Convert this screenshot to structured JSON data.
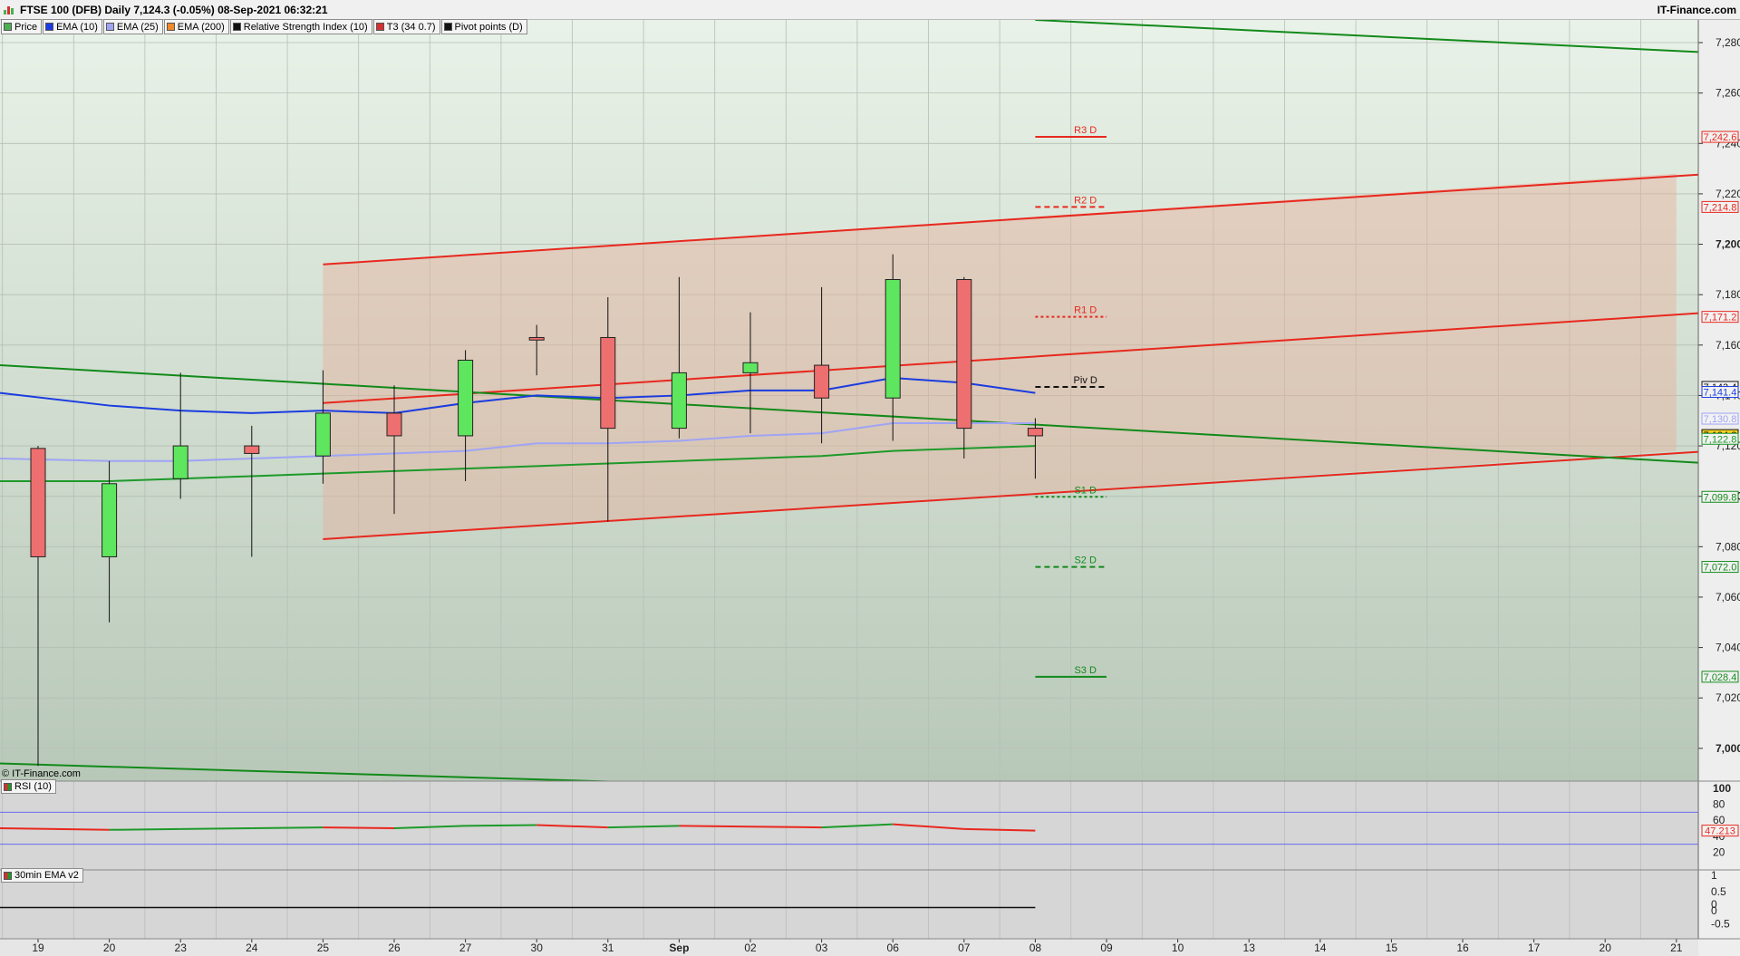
{
  "header": {
    "title": "FTSE 100 (DFB) Daily 7,124.3 (-0.05%) 08-Sep-2021 06:32:21",
    "brand": "IT-Finance.com"
  },
  "legend": [
    {
      "label": "Price",
      "color": "#4caf50"
    },
    {
      "label": "EMA (10)",
      "color": "#1a3ce0"
    },
    {
      "label": "EMA (25)",
      "color": "#9fa4f5"
    },
    {
      "label": "EMA (200)",
      "color": "#f08a2a"
    },
    {
      "label": "Relative Strength Index (10)",
      "color": "#111111"
    },
    {
      "label": "T3 (34 0.7)",
      "color": "#d63030"
    },
    {
      "label": "Pivot points (D)",
      "color": "#111111"
    }
  ],
  "copyright": "© IT-Finance.com",
  "rsi_panel": {
    "label": "RSI (10)",
    "value_tag": "47.213",
    "ticks": [
      "100",
      "80",
      "60",
      "40",
      "20"
    ]
  },
  "ema_panel": {
    "label": "30min EMA v2",
    "ticks": [
      "1",
      "0.5",
      "0",
      "0",
      "-0.5"
    ]
  },
  "colors": {
    "up": "#5ee65e",
    "down": "#ee6f6f",
    "ema10": "#1a3ce0",
    "ema25": "#9fa4f5",
    "ema200": "#1d9a2a",
    "channel_red": "#e8281e",
    "channel_green": "#128a1a",
    "pivot_red": "#e8281e",
    "pivot_green": "#128a1a"
  },
  "chart_data": {
    "type": "candlestick",
    "title": "FTSE 100 (DFB) Daily",
    "y_axis": {
      "ylim": [
        6987,
        7289
      ],
      "ticks": [
        7000,
        7020,
        7040,
        7060,
        7080,
        7100,
        7120,
        7140,
        7160,
        7180,
        7200,
        7220,
        7240,
        7260,
        7280
      ],
      "tick_labels": [
        "7,000",
        "7,020",
        "7,040",
        "7,060",
        "7,080",
        "7,100",
        "7,120",
        "7,140",
        "7,160",
        "7,180",
        "7,200",
        "7,220",
        "7,240",
        "7,260",
        "7,280"
      ]
    },
    "x_labels": [
      "19",
      "20",
      "23",
      "24",
      "25",
      "26",
      "27",
      "30",
      "31",
      "Sep",
      "02",
      "03",
      "06",
      "07",
      "08",
      "09",
      "10",
      "13",
      "14",
      "15",
      "16",
      "17",
      "20",
      "21"
    ],
    "candles": [
      {
        "date": "19",
        "open": 7119,
        "high": 7120,
        "low": 6993,
        "close": 7076
      },
      {
        "date": "20",
        "open": 7076,
        "high": 7114,
        "low": 7050,
        "close": 7105
      },
      {
        "date": "23",
        "open": 7107,
        "high": 7149,
        "low": 7099,
        "close": 7120
      },
      {
        "date": "24",
        "open": 7120,
        "high": 7128,
        "low": 7076,
        "close": 7117
      },
      {
        "date": "25",
        "open": 7116,
        "high": 7150,
        "low": 7105,
        "close": 7133
      },
      {
        "date": "26",
        "open": 7133,
        "high": 7144,
        "low": 7093,
        "close": 7124
      },
      {
        "date": "27",
        "open": 7124,
        "high": 7158,
        "low": 7106,
        "close": 7154
      },
      {
        "date": "30",
        "open": 7163,
        "high": 7168,
        "low": 7148,
        "close": 7162
      },
      {
        "date": "31",
        "open": 7163,
        "high": 7179,
        "low": 7090,
        "close": 7127
      },
      {
        "date": "Sep",
        "open": 7127,
        "high": 7187,
        "low": 7123,
        "close": 7149
      },
      {
        "date": "02",
        "open": 7149,
        "high": 7173,
        "low": 7125,
        "close": 7153
      },
      {
        "date": "03",
        "open": 7152,
        "high": 7183,
        "low": 7121,
        "close": 7139
      },
      {
        "date": "06",
        "open": 7139,
        "high": 7196,
        "low": 7122,
        "close": 7186
      },
      {
        "date": "07",
        "open": 7186,
        "high": 7187,
        "low": 7115,
        "close": 7127
      },
      {
        "date": "08",
        "open": 7127,
        "high": 7131,
        "low": 7107,
        "close": 7124
      }
    ],
    "ema10": [
      7141,
      7136,
      7134,
      7133,
      7134,
      7133,
      7137,
      7140,
      7139,
      7140,
      7142,
      7142,
      7147,
      7145,
      7141
    ],
    "ema25": [
      7115,
      7114,
      7114,
      7115,
      7116,
      7117,
      7118,
      7121,
      7121,
      7122,
      7124,
      7125,
      7129,
      7129,
      7129
    ],
    "ema200": [
      7106,
      7106,
      7107,
      7108,
      7109,
      7110,
      7111,
      7112,
      7113,
      7114,
      7115,
      7116,
      7118,
      7119,
      7120
    ],
    "channels": [
      {
        "color": "red",
        "from": {
          "x": "25",
          "y": 7192
        },
        "to": {
          "x": "21",
          "y": 7228
        }
      },
      {
        "color": "red",
        "from": {
          "x": "25",
          "y": 7137
        },
        "to": {
          "x": "21",
          "y": 7173
        }
      },
      {
        "color": "red",
        "from": {
          "x": "25",
          "y": 7083
        },
        "to": {
          "x": "21",
          "y": 7118
        }
      },
      {
        "color": "green",
        "from": {
          "x": "19",
          "y": 7152
        },
        "to": {
          "x": "21",
          "y": 7113
        }
      },
      {
        "color": "green",
        "from": {
          "x": "08",
          "y": 7289
        },
        "to": {
          "x": "21",
          "y": 7276
        }
      },
      {
        "color": "green",
        "from": {
          "x": "19",
          "y": 6994
        },
        "to": {
          "x": "Sep",
          "y": 6986
        }
      }
    ],
    "pivots": [
      {
        "label": "R3 D",
        "value": 7242.6,
        "tag": "7,242.6",
        "color": "red",
        "style": "solid"
      },
      {
        "label": "R2 D",
        "value": 7214.8,
        "tag": "7,214.8",
        "color": "red",
        "style": "dashed"
      },
      {
        "label": "R1 D",
        "value": 7171.2,
        "tag": "7,171.2",
        "color": "red",
        "style": "dotted"
      },
      {
        "label": "Piv D",
        "value": 7143.4,
        "tag": "7,143.4",
        "color": "black",
        "style": "dashed"
      },
      {
        "label": "S1 D",
        "value": 7099.8,
        "tag": "7,099.8",
        "color": "green",
        "style": "dotted"
      },
      {
        "label": "S2 D",
        "value": 7072.0,
        "tag": "7,072.0",
        "color": "green",
        "style": "dashed"
      },
      {
        "label": "S3 D",
        "value": 7028.4,
        "tag": "7,028.4",
        "color": "green",
        "style": "solid"
      }
    ],
    "price_tags": [
      {
        "text": "7,141.4",
        "value": 7141.4,
        "color": "ema10"
      },
      {
        "text": "7,130.8",
        "value": 7130.8,
        "color": "ema25"
      },
      {
        "text": "7,124.3",
        "value": 7124.3,
        "color": "price"
      },
      {
        "text": "7,122.8",
        "value": 7122.8,
        "color": "ema200"
      }
    ],
    "rsi": {
      "values": [
        50,
        48,
        49,
        50,
        51,
        50,
        53,
        54,
        51,
        53,
        52,
        51,
        55,
        49,
        47
      ],
      "levels": [
        70,
        30
      ],
      "ylim": [
        0,
        100
      ]
    },
    "ema_osc": {
      "values": [
        0,
        0,
        0,
        0,
        0,
        0,
        0,
        0,
        0,
        0,
        0,
        0,
        0,
        0,
        0
      ],
      "ylim": [
        -0.8,
        1
      ]
    }
  }
}
